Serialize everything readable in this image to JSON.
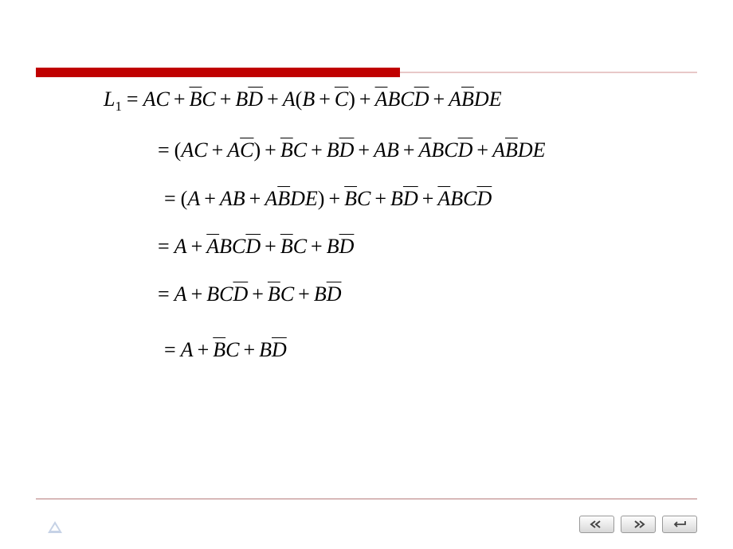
{
  "equation": {
    "lhs": {
      "var": "L",
      "sub": "1"
    },
    "lines": {
      "l1": {
        "t1": "AC",
        "t2a": "B",
        "t2b": "C",
        "t3a": "B",
        "t3b": "D",
        "t4a": "A",
        "t4b": "B",
        "t4c": "C",
        "t5a": "A",
        "t5b": "BC",
        "t5c": "D",
        "t6a": "A",
        "t6b": "B",
        "t6c": "DE"
      },
      "l2": {
        "t1": "AC",
        "t2a": "A",
        "t2b": "C",
        "t3a": "B",
        "t3b": "C",
        "t4a": "B",
        "t4b": "D",
        "t5": "AB",
        "t6a": "A",
        "t6b": "BC",
        "t6c": "D",
        "t7a": "A",
        "t7b": "B",
        "t7c": "DE"
      },
      "l3": {
        "t1": "A",
        "t2": "AB",
        "t3a": "A",
        "t3b": "B",
        "t3c": "DE",
        "t4a": "B",
        "t4b": "C",
        "t5a": "B",
        "t5b": "D",
        "t6a": "A",
        "t6b": "BC",
        "t6c": "D"
      },
      "l4": {
        "t1": "A",
        "t2a": "A",
        "t2b": "BC",
        "t2c": "D",
        "t3a": "B",
        "t3b": "C",
        "t4a": "B",
        "t4b": "D"
      },
      "l5": {
        "t1": "A",
        "t2a": "BC",
        "t2b": "D",
        "t3a": "B",
        "t3b": "C",
        "t4a": "B",
        "t4b": "D"
      },
      "l6": {
        "t1": "A",
        "t2a": "B",
        "t2b": "C",
        "t3a": "B",
        "t3b": "D"
      }
    }
  },
  "nav": {
    "prev": "‹‹",
    "next": "››",
    "enter": "↵"
  }
}
